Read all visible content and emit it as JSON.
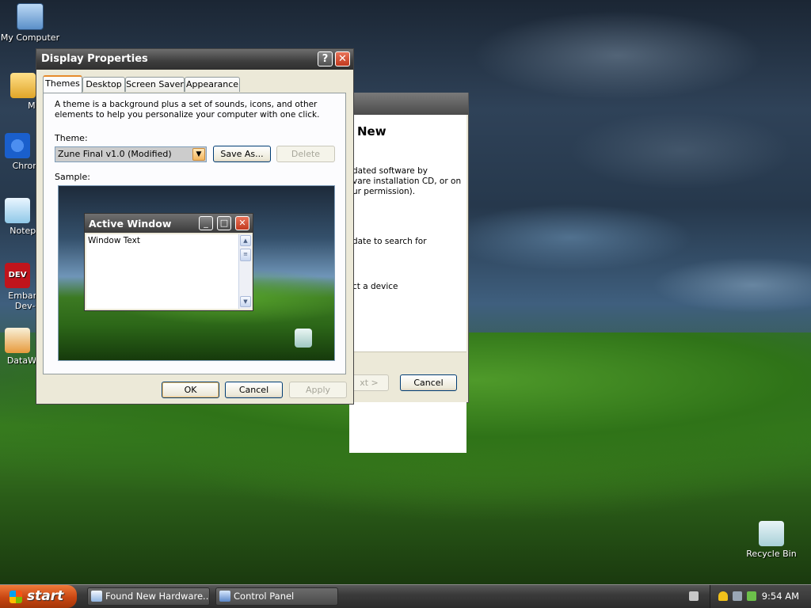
{
  "desktop": {
    "icons": [
      {
        "label": "My Computer",
        "icon": "my-computer-icon"
      },
      {
        "label": "MyPa",
        "icon": "folder-shortcut-icon"
      },
      {
        "label": "Chrom",
        "icon": "chrome-icon"
      },
      {
        "label": "Notepa",
        "icon": "notepad-icon"
      },
      {
        "label": "Embarc",
        "label2": "Dev-C",
        "icon": "dev-cpp-icon",
        "badge": "DEV"
      },
      {
        "label": "DataWa",
        "icon": "datawatch-icon"
      },
      {
        "label": "Recycle Bin",
        "icon": "recycle-bin-icon"
      }
    ]
  },
  "back_window": {
    "title_fragment": "New",
    "lines": [
      "dated software by",
      "vare installation CD, or on",
      "ur permission).",
      "date to search for",
      "ct a device"
    ],
    "next_label": "xt >",
    "cancel_label": "Cancel"
  },
  "display_properties": {
    "title": "Display Properties",
    "help_glyph": "?",
    "close_glyph": "✕",
    "tabs": [
      "Themes",
      "Desktop",
      "Screen Saver",
      "Appearance"
    ],
    "active_tab": "Themes",
    "description": "A theme is a background plus a set of sounds, icons, and other elements to help you personalize your computer with one click.",
    "theme_label": "Theme:",
    "theme_value": "Zune Final v1.0 (Modified)",
    "save_as_label": "Save As...",
    "delete_label": "Delete",
    "sample_label": "Sample:",
    "sample_window": {
      "title": "Active Window",
      "text": "Window Text"
    },
    "ok_label": "OK",
    "cancel_label": "Cancel",
    "apply_label": "Apply"
  },
  "taskbar": {
    "start_label": "start",
    "tasks": [
      {
        "label": "Found New Hardware...",
        "icon": "hardware-wizard-icon"
      },
      {
        "label": "Control Panel",
        "icon": "control-panel-icon"
      }
    ],
    "clock": "9:54 AM"
  }
}
